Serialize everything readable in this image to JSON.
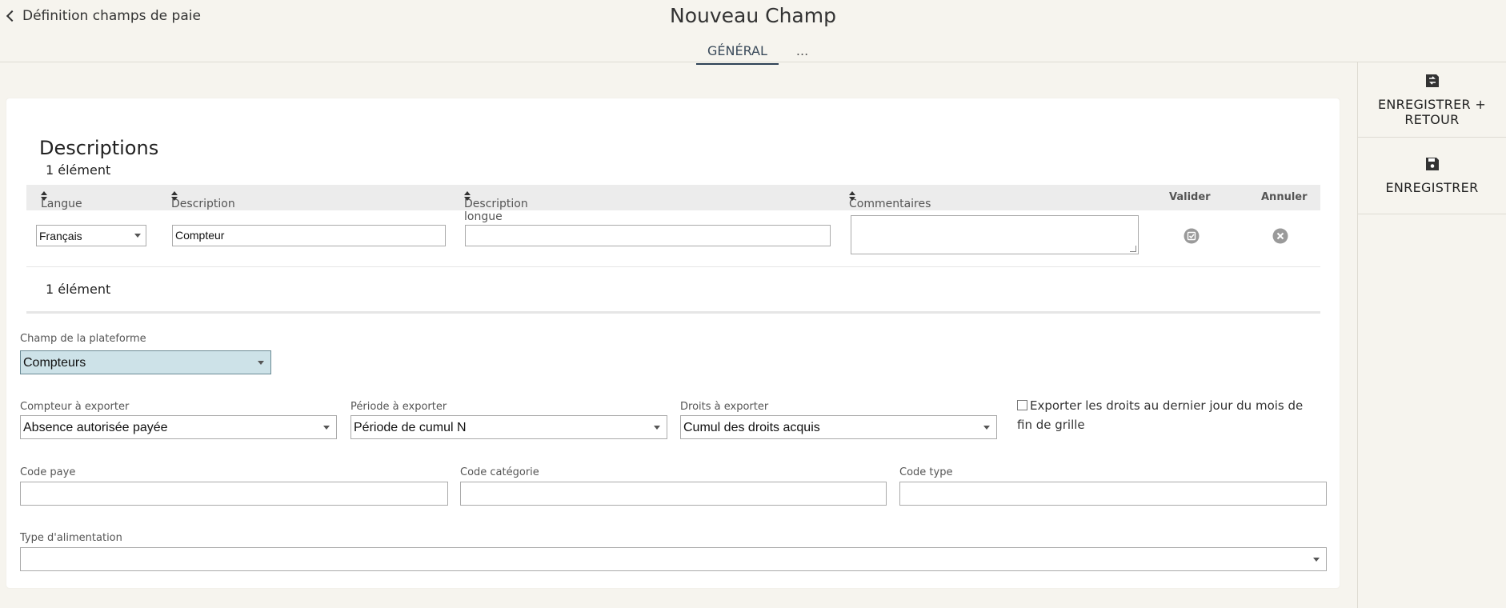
{
  "header": {
    "back_label": "Définition champs de paie",
    "title": "Nouveau Champ",
    "tabs": [
      {
        "label": "GÉNÉRAL",
        "active": true
      },
      {
        "label": "..."
      }
    ]
  },
  "actions": {
    "save_return_label": "ENREGISTRER + RETOUR",
    "save_label": "ENREGISTRER"
  },
  "descriptions": {
    "title": "Descriptions",
    "count_top": "1 élément",
    "count_bottom": "1 élément",
    "columns": {
      "langue": "Langue",
      "description": "Description",
      "description_longue": "Description longue",
      "commentaires": "Commentaires",
      "valider": "Valider",
      "annuler": "Annuler"
    },
    "row": {
      "langue": "Français",
      "description": "Compteur",
      "description_longue": "",
      "commentaires": ""
    }
  },
  "form": {
    "champ_plateforme": {
      "label": "Champ de la plateforme",
      "value": "Compteurs"
    },
    "compteur": {
      "label": "Compteur à exporter",
      "value": "Absence autorisée payée"
    },
    "periode": {
      "label": "Période à exporter",
      "value": "Période de cumul N"
    },
    "droits": {
      "label": "Droits à exporter",
      "value": "Cumul des droits acquis"
    },
    "export_checkbox": {
      "label": "Exporter les droits au dernier jour du mois de fin de grille",
      "checked": false
    },
    "code_paye": {
      "label": "Code paye",
      "value": ""
    },
    "code_categorie": {
      "label": "Code catégorie",
      "value": ""
    },
    "code_type": {
      "label": "Code type",
      "value": ""
    },
    "type_alimentation": {
      "label": "Type d'alimentation",
      "value": ""
    }
  },
  "colors": {
    "background": "#f6f4ee",
    "highlight_select": "#cde2e8",
    "tab_underline": "#2e4256"
  },
  "icons": {
    "back": "chevron-left-icon",
    "save_return": "save-return-icon",
    "save": "floppy-disk-icon",
    "validate": "check-circle-icon",
    "cancel": "close-circle-icon"
  }
}
